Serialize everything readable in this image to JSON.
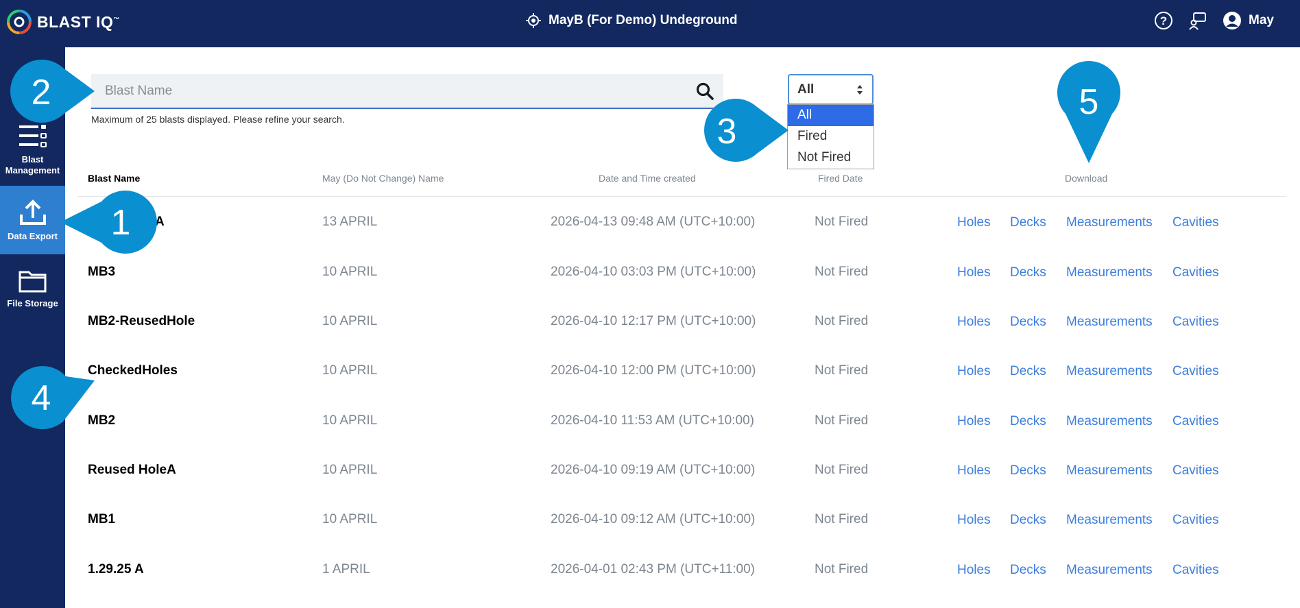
{
  "app": {
    "logo_text": "BLAST IQ",
    "logo_mark": "™"
  },
  "header": {
    "site_name": "MayB (For Demo) Undeground",
    "user_name": "May"
  },
  "sidebar": {
    "items": [
      {
        "label_line1": "Blast",
        "label_line2": "Management"
      },
      {
        "label": "Data Export"
      },
      {
        "label": "File Storage"
      }
    ]
  },
  "search": {
    "placeholder": "Blast Name",
    "note": "Maximum of 25 blasts displayed. Please refine your search."
  },
  "filter": {
    "selected": "All",
    "options": [
      "All",
      "Fired",
      "Not Fired"
    ]
  },
  "table": {
    "headers": [
      "Blast Name",
      "May (Do Not Change) Name",
      "Date and Time created",
      "Fired Date",
      "Download"
    ],
    "links": [
      "Holes",
      "Decks",
      "Measurements",
      "Cavities"
    ],
    "rows": [
      {
        "name": "A",
        "alt": "13 APRIL",
        "created": "2026-04-13 09:48 AM (UTC+10:00)",
        "fired": "Not Fired"
      },
      {
        "name": "MB3",
        "alt": "10 APRIL",
        "created": "2026-04-10 03:03 PM (UTC+10:00)",
        "fired": "Not Fired"
      },
      {
        "name": "MB2-ReusedHole",
        "alt": "10 APRIL",
        "created": "2026-04-10 12:17 PM (UTC+10:00)",
        "fired": "Not Fired"
      },
      {
        "name": "CheckedHoles",
        "alt": "10 APRIL",
        "created": "2026-04-10 12:00 PM (UTC+10:00)",
        "fired": "Not Fired"
      },
      {
        "name": "MB2",
        "alt": "10 APRIL",
        "created": "2026-04-10 11:53 AM (UTC+10:00)",
        "fired": "Not Fired"
      },
      {
        "name": "Reused HoleA",
        "alt": "10 APRIL",
        "created": "2026-04-10 09:19 AM (UTC+10:00)",
        "fired": "Not Fired"
      },
      {
        "name": "MB1",
        "alt": "10 APRIL",
        "created": "2026-04-10 09:12 AM (UTC+10:00)",
        "fired": "Not Fired"
      },
      {
        "name": "1.29.25 A",
        "alt": "1 APRIL",
        "created": "2026-04-01 02:43 PM (UTC+11:00)",
        "fired": "Not Fired"
      }
    ]
  },
  "callouts": [
    "1",
    "2",
    "3",
    "4",
    "5"
  ],
  "colors": {
    "navy": "#12285e",
    "active": "#2f7fd0",
    "link": "#3b7ddd",
    "callout": "#0a8fd0"
  }
}
